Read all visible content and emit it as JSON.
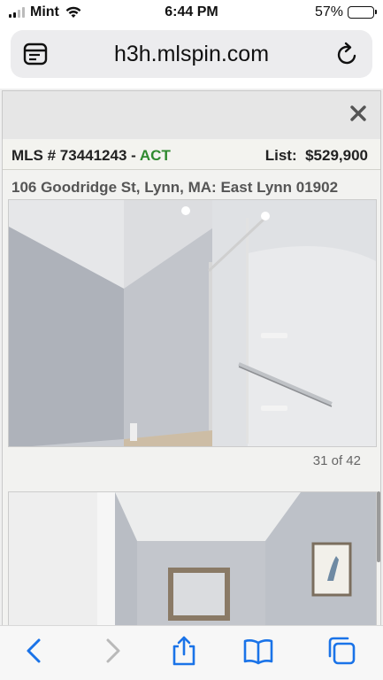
{
  "status_bar": {
    "carrier": "Mint",
    "time": "6:44 PM",
    "battery": "57%",
    "battery_level": 0.57
  },
  "browser": {
    "url": "h3h.mlspin.com"
  },
  "listing": {
    "mls_label": "MLS # 73441243 - ",
    "status": "ACT",
    "status_color": "#2f8a2f",
    "list_label": "List:",
    "price": "$529,900",
    "address": "106 Goodridge St, Lynn, MA: East Lynn 01902"
  },
  "gallery": {
    "counter": "31 of 42"
  },
  "icons": {
    "close": "close-icon",
    "tabs": "tabs-icon",
    "reload": "reload-icon",
    "back": "back-chevron-icon",
    "forward": "forward-chevron-icon",
    "share": "share-icon",
    "bookmarks": "book-icon",
    "tab_switcher": "tab-switcher-icon"
  }
}
